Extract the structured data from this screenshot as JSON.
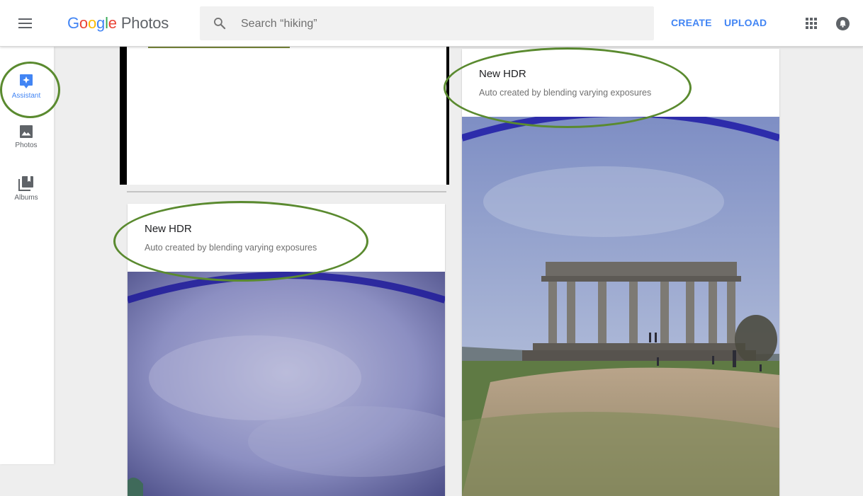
{
  "header": {
    "logo_google": [
      "G",
      "o",
      "o",
      "g",
      "l",
      "e"
    ],
    "logo_product": "Photos",
    "search_placeholder": "Search “hiking”",
    "create_label": "CREATE",
    "upload_label": "UPLOAD"
  },
  "sidebar": {
    "items": [
      {
        "label": "Assistant",
        "icon": "assistant-icon",
        "active": true
      },
      {
        "label": "Photos",
        "icon": "photo-icon",
        "active": false
      },
      {
        "label": "Albums",
        "icon": "albums-icon",
        "active": false
      }
    ]
  },
  "cards": [
    {
      "title": "New HDR",
      "subtitle": "Auto created by blending varying exposures"
    },
    {
      "title": "New HDR",
      "subtitle": "Auto created by blending varying exposures"
    }
  ],
  "colors": {
    "accent": "#4285f4",
    "annotation_circle": "#5a8a2f"
  }
}
